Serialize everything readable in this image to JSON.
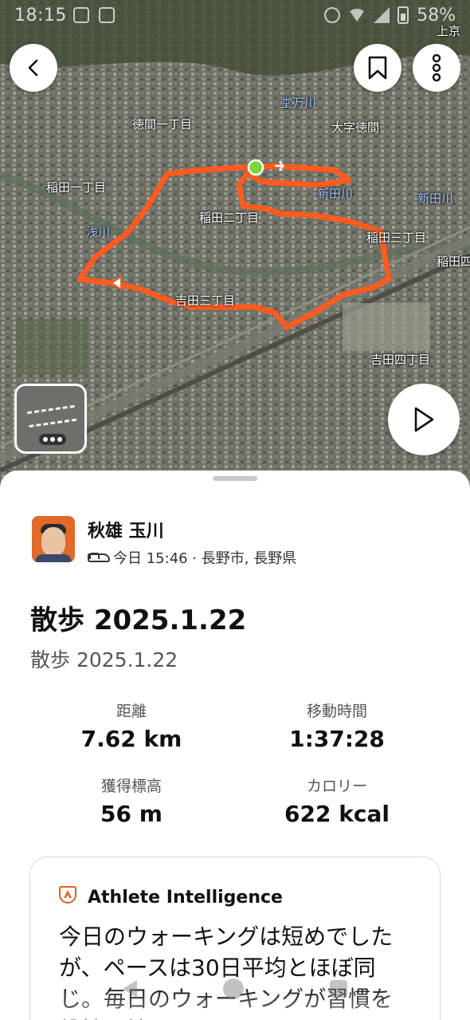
{
  "status_bar": {
    "time": "18:15",
    "battery": "58%"
  },
  "map": {
    "labels": {
      "tokuma_1": "徳間一丁目",
      "tokuma_aza": "大字徳間",
      "dogawa": "堂万川",
      "inada_1": "稲田一丁目",
      "inada_2": "稲田二丁目",
      "inada_3": "稲田三丁目",
      "inada_edge": "稲田四",
      "shindagawa_1": "新田川",
      "shindagawa_2": "新田川",
      "asagawa": "浅川",
      "yoshida_3": "吉田三丁目",
      "yoshida_4": "吉田四丁目",
      "kamiyasu": "上京"
    }
  },
  "athlete": {
    "name": "秋雄 玉川",
    "meta": "今日 15:46 · 長野市, 長野県"
  },
  "activity": {
    "title": "散歩 2025.1.22",
    "description": "散歩 2025.1.22"
  },
  "stats": {
    "distance": {
      "label": "距離",
      "value": "7.62 km"
    },
    "moving_time": {
      "label": "移動時間",
      "value": "1:37:28"
    },
    "elevation": {
      "label": "獲得標高",
      "value": "56 m"
    },
    "calories": {
      "label": "カロリー",
      "value": "622 kcal"
    }
  },
  "ai": {
    "title": "Athlete Intelligence",
    "text": "今日のウォーキングは短めでしたが、ペースは30日平均とほぼ同じ。毎日のウォーキングが習慣を維持し続け..."
  },
  "colors": {
    "route": "#ff5a1f",
    "accent": "#e4601b",
    "start": "#7cd63a"
  }
}
